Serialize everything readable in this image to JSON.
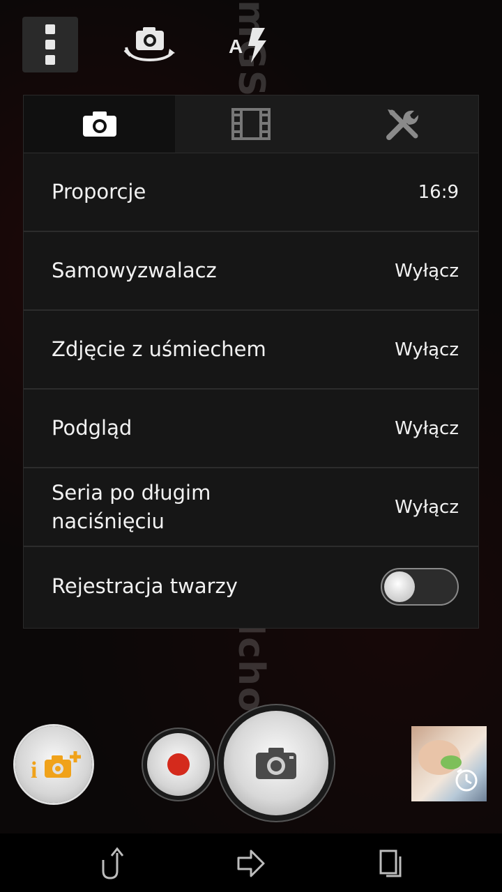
{
  "top_bar": {
    "menu_icon": "overflow-menu-icon",
    "switch_camera_icon": "switch-camera-icon",
    "flash_icon": "flash-auto-icon",
    "flash_label": "A"
  },
  "settings_panel": {
    "tabs": [
      {
        "icon": "camera-icon",
        "active": true
      },
      {
        "icon": "film-icon",
        "active": false
      },
      {
        "icon": "tools-icon",
        "active": false
      }
    ],
    "rows": [
      {
        "label": "Proporcje",
        "value": "16:9"
      },
      {
        "label": "Samowyzwalacz",
        "value": "Wyłącz"
      },
      {
        "label": "Zdjęcie z uśmiechem",
        "value": "Wyłącz"
      },
      {
        "label": "Podgląd",
        "value": "Wyłącz"
      },
      {
        "label": "Seria po długim naciśnięciu",
        "value": "Wyłącz"
      },
      {
        "label": "Rejestracja twarzy",
        "toggle": false
      }
    ]
  },
  "watermark": {
    "text_upper": "mGSMchoice",
    "text_lower": "mGSMchoice"
  },
  "capture_controls": {
    "smart_mode_label": "i",
    "record_icon": "record-icon",
    "shutter_icon": "camera-icon",
    "thumbnail_icon": "timer-icon"
  },
  "nav_bar": {
    "back_icon": "back-icon",
    "home_icon": "home-icon",
    "recents_icon": "recents-icon"
  },
  "colors": {
    "record_red": "#d42a1c",
    "smart_orange": "#f0a21a",
    "panel_bg": "#161616"
  }
}
